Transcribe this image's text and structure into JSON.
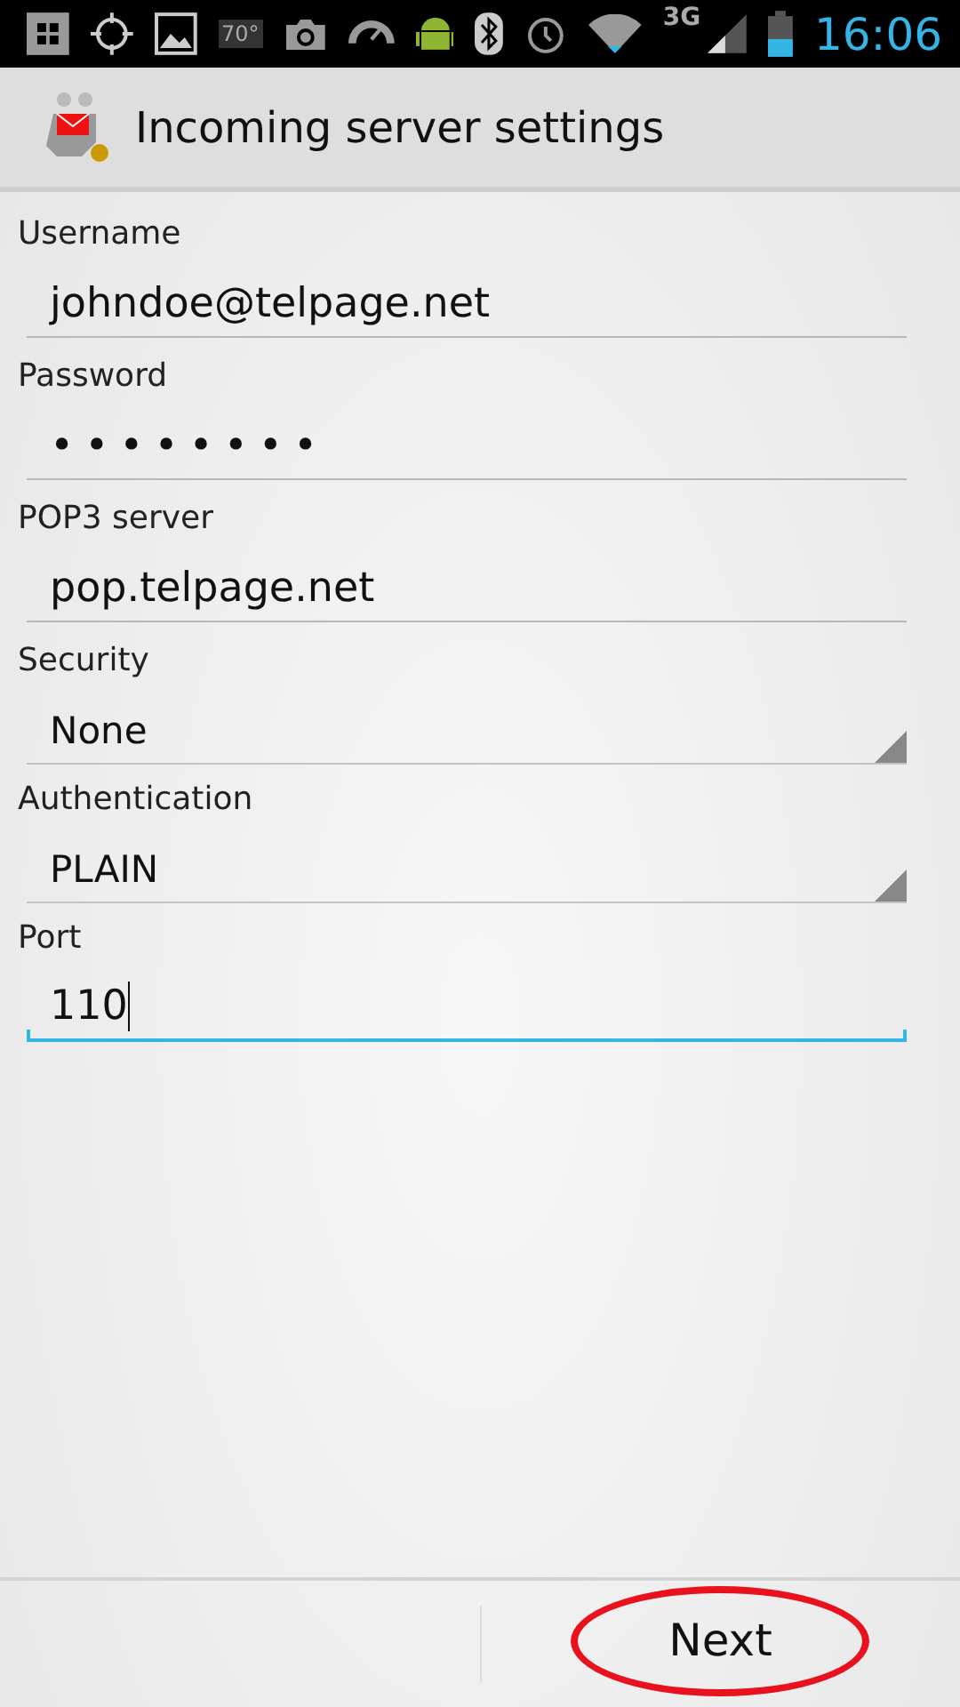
{
  "status_bar": {
    "temperature": "70°",
    "network": "3G",
    "time": "16:06"
  },
  "action_bar": {
    "title": "Incoming server settings"
  },
  "fields": [
    {
      "kind": "text",
      "label": "Username",
      "value": "johndoe@telpage.net",
      "focused": false
    },
    {
      "kind": "password",
      "label": "Password",
      "value": "••••••••",
      "focused": false
    },
    {
      "kind": "text",
      "label": "POP3 server",
      "value": "pop.telpage.net",
      "focused": false
    },
    {
      "kind": "spinner",
      "label": "Security",
      "value": "None",
      "focused": false
    },
    {
      "kind": "spinner",
      "label": "Authentication",
      "value": "PLAIN",
      "focused": false
    },
    {
      "kind": "text",
      "label": "Port",
      "value": "110",
      "focused": true
    }
  ],
  "buttons": [
    {
      "label": "Next",
      "highlighted": true
    }
  ]
}
